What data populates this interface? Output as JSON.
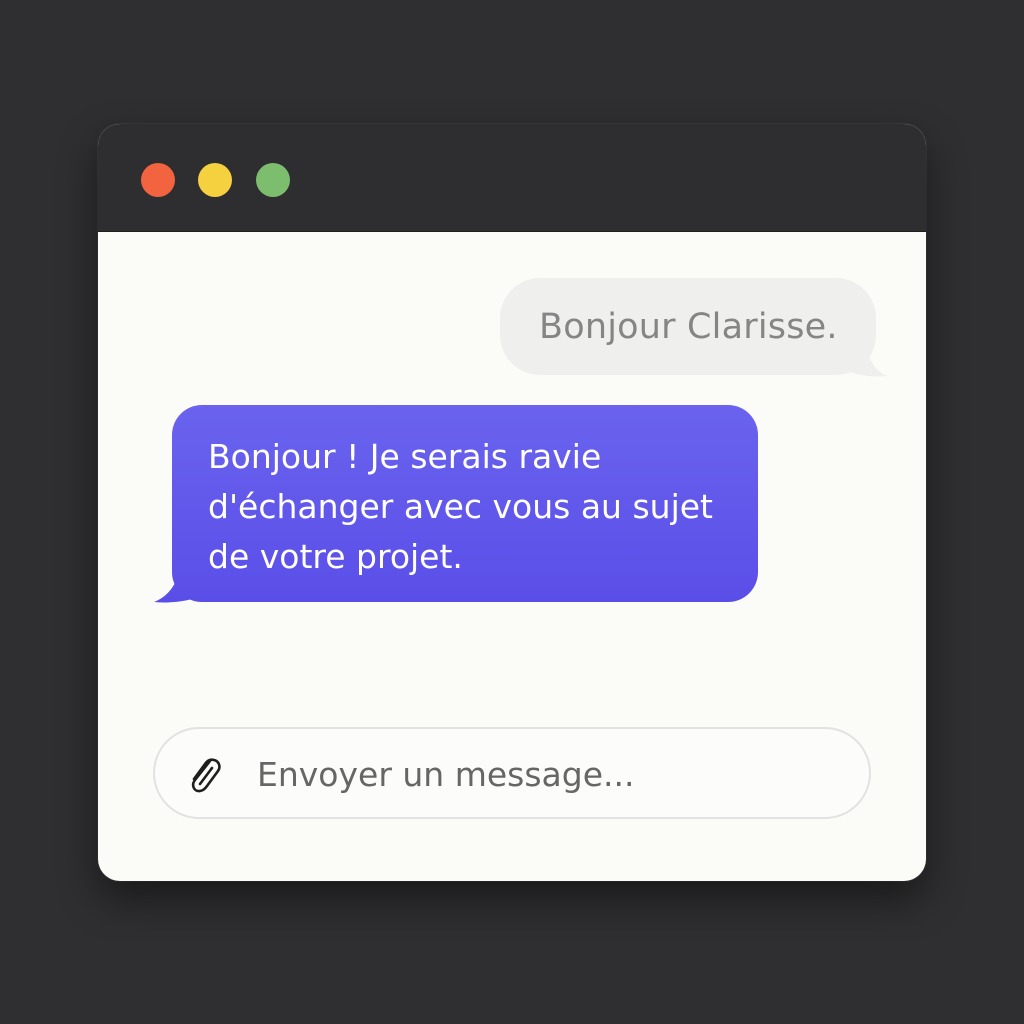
{
  "window": {
    "controls": {
      "close_color": "#f2643f",
      "minimize_color": "#f5d140",
      "zoom_color": "#7dbd6e"
    }
  },
  "conversation": {
    "messages": [
      {
        "side": "right",
        "style": "gray",
        "text": "Bonjour Clarisse."
      },
      {
        "side": "left",
        "style": "purple",
        "text": "Bonjour ! Je serais ravie d'échanger avec vous au sujet de votre projet."
      }
    ]
  },
  "composer": {
    "attach_icon": "paperclip-icon",
    "placeholder": "Envoyer un message...",
    "value": ""
  },
  "colors": {
    "accent": "#5a4ee8",
    "gray_bubble": "#efefed",
    "titlebar": "#2e2d2f",
    "background": "#2f2e30"
  }
}
